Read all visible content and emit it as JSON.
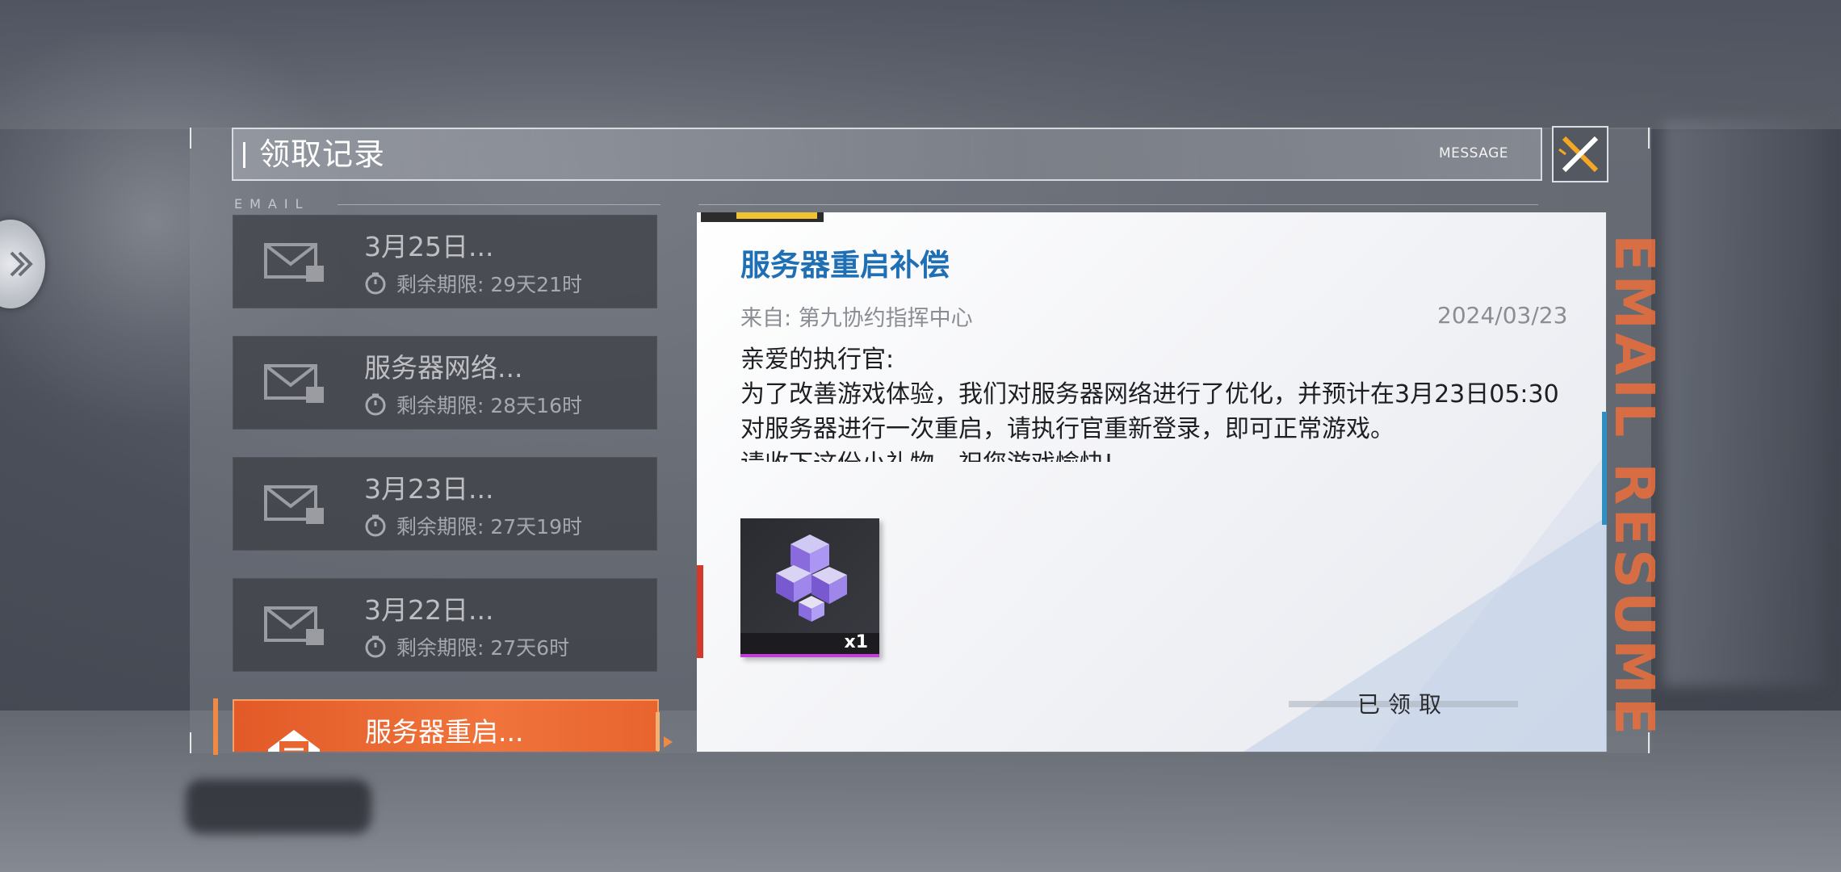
{
  "header": {
    "title": "领取记录",
    "subtitle": "MESSAGE"
  },
  "list_label": "EMAIL",
  "mail_items": [
    {
      "title": "3月25日...",
      "timer": "剩余期限: 29天21时"
    },
    {
      "title": "服务器网络...",
      "timer": "剩余期限: 28天16时"
    },
    {
      "title": "3月23日...",
      "timer": "剩余期限: 27天19时"
    },
    {
      "title": "3月22日...",
      "timer": "剩余期限: 27天6时"
    },
    {
      "title": "服务器重启..."
    }
  ],
  "message": {
    "title": "服务器重启补偿",
    "from": "来自: 第九协约指挥中心",
    "date": "2024/03/23",
    "greeting": "亲爱的执行官:",
    "body1": "为了改善游戏体验，我们对服务器网络进行了优化，并预计在3月23日05:30对服务器进行一次重启，请执行官重新登录，即可正常游戏。",
    "body2": "请收下这份小礼物，祝您游戏愉快!",
    "reward_qty": "x1",
    "status": "已领取"
  },
  "side_decor_text": "EMAIL RESUME",
  "colors": {
    "accent": "#f0743c",
    "title_blue": "#1f6fb5",
    "close_orange": "#f5a623"
  }
}
